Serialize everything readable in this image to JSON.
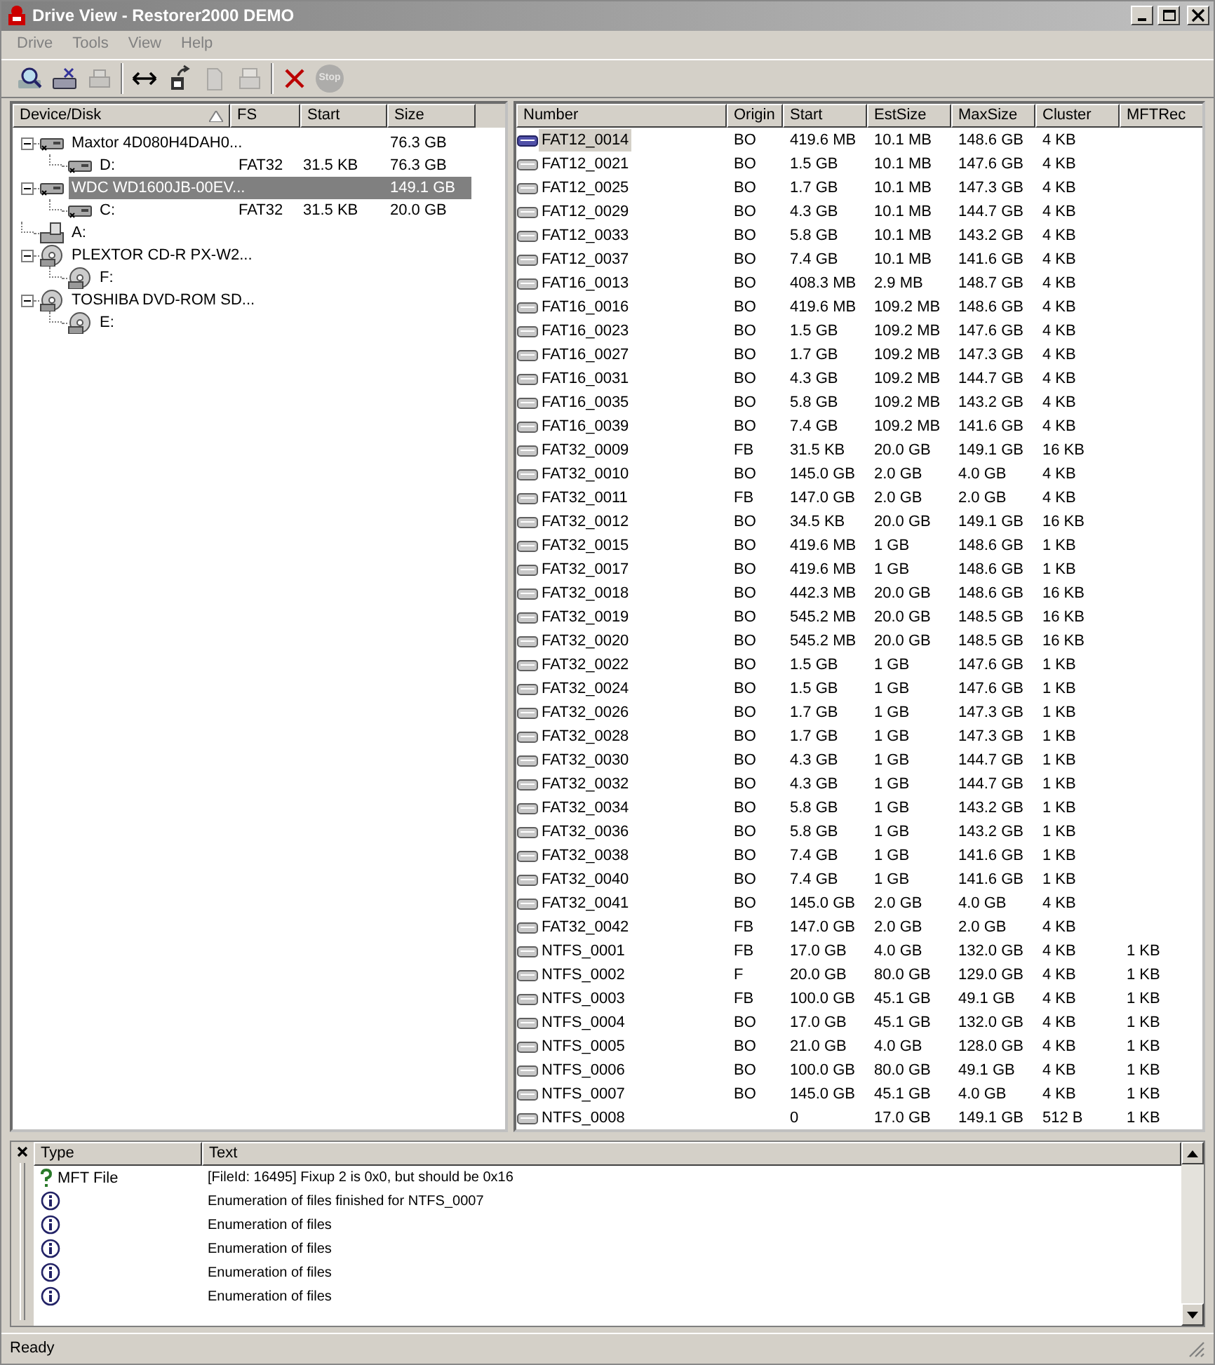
{
  "window": {
    "title": "Drive View - Restorer2000 DEMO"
  },
  "menu": [
    "Drive",
    "Tools",
    "View",
    "Help"
  ],
  "toolbar": [
    {
      "kind": "search",
      "disabled": false
    },
    {
      "kind": "drive",
      "disabled": false
    },
    {
      "kind": "printer",
      "disabled": true
    },
    {
      "kind": "sep"
    },
    {
      "kind": "arrows",
      "disabled": false
    },
    {
      "kind": "export",
      "disabled": false
    },
    {
      "kind": "file",
      "disabled": true
    },
    {
      "kind": "tray",
      "disabled": true
    },
    {
      "kind": "sep"
    },
    {
      "kind": "delete",
      "disabled": false
    },
    {
      "kind": "stop",
      "label": "Stop",
      "disabled": true
    }
  ],
  "tree": {
    "columns": [
      "Device/Disk",
      "FS",
      "Start",
      "Size"
    ],
    "items": [
      {
        "kind": "hdd",
        "label": "Maxtor 4D080H4DAH0...",
        "size": "76.3 GB",
        "selected": false,
        "expanded": true,
        "children": [
          {
            "kind": "hdd",
            "label": "D:",
            "fs": "FAT32",
            "start": "31.5 KB",
            "size": "76.3 GB",
            "selected": false
          }
        ]
      },
      {
        "kind": "hdd",
        "label": "WDC WD1600JB-00EV...",
        "size": "149.1 GB",
        "selected": true,
        "expanded": true,
        "children": [
          {
            "kind": "hdd",
            "label": "C:",
            "fs": "FAT32",
            "start": "31.5 KB",
            "size": "20.0 GB",
            "selected": false
          }
        ]
      },
      {
        "kind": "floppy",
        "label": "A:",
        "selected": false
      },
      {
        "kind": "cd",
        "label": "PLEXTOR CD-R PX-W2...",
        "selected": false,
        "expanded": true,
        "children": [
          {
            "kind": "cd",
            "label": "F:",
            "selected": false
          }
        ]
      },
      {
        "kind": "cd",
        "label": "TOSHIBA DVD-ROM SD...",
        "selected": false,
        "expanded": true,
        "children": [
          {
            "kind": "cd",
            "label": "E:",
            "selected": false
          }
        ]
      }
    ]
  },
  "table": {
    "columns": [
      "Number",
      "Origin",
      "Start",
      "EstSize",
      "MaxSize",
      "Cluster",
      "MFTRec"
    ],
    "rows": [
      {
        "number": "FAT12_0014",
        "origin": "BO",
        "start": "419.6 MB",
        "est_size": "10.1 MB",
        "max_size": "148.6 GB",
        "cluster": "4 KB",
        "selected": true
      },
      {
        "number": "FAT12_0021",
        "origin": "BO",
        "start": "1.5 GB",
        "est_size": "10.1 MB",
        "max_size": "147.6 GB",
        "cluster": "4 KB",
        "selected": false
      },
      {
        "number": "FAT12_0025",
        "origin": "BO",
        "start": "1.7 GB",
        "est_size": "10.1 MB",
        "max_size": "147.3 GB",
        "cluster": "4 KB",
        "selected": false
      },
      {
        "number": "FAT12_0029",
        "origin": "BO",
        "start": "4.3 GB",
        "est_size": "10.1 MB",
        "max_size": "144.7 GB",
        "cluster": "4 KB",
        "selected": false
      },
      {
        "number": "FAT12_0033",
        "origin": "BO",
        "start": "5.8 GB",
        "est_size": "10.1 MB",
        "max_size": "143.2 GB",
        "cluster": "4 KB",
        "selected": false
      },
      {
        "number": "FAT12_0037",
        "origin": "BO",
        "start": "7.4 GB",
        "est_size": "10.1 MB",
        "max_size": "141.6 GB",
        "cluster": "4 KB",
        "selected": false
      },
      {
        "number": "FAT16_0013",
        "origin": "BO",
        "start": "408.3 MB",
        "est_size": "2.9 MB",
        "max_size": "148.7 GB",
        "cluster": "4 KB",
        "selected": false
      },
      {
        "number": "FAT16_0016",
        "origin": "BO",
        "start": "419.6 MB",
        "est_size": "109.2 MB",
        "max_size": "148.6 GB",
        "cluster": "4 KB",
        "selected": false
      },
      {
        "number": "FAT16_0023",
        "origin": "BO",
        "start": "1.5 GB",
        "est_size": "109.2 MB",
        "max_size": "147.6 GB",
        "cluster": "4 KB",
        "selected": false
      },
      {
        "number": "FAT16_0027",
        "origin": "BO",
        "start": "1.7 GB",
        "est_size": "109.2 MB",
        "max_size": "147.3 GB",
        "cluster": "4 KB",
        "selected": false
      },
      {
        "number": "FAT16_0031",
        "origin": "BO",
        "start": "4.3 GB",
        "est_size": "109.2 MB",
        "max_size": "144.7 GB",
        "cluster": "4 KB",
        "selected": false
      },
      {
        "number": "FAT16_0035",
        "origin": "BO",
        "start": "5.8 GB",
        "est_size": "109.2 MB",
        "max_size": "143.2 GB",
        "cluster": "4 KB",
        "selected": false
      },
      {
        "number": "FAT16_0039",
        "origin": "BO",
        "start": "7.4 GB",
        "est_size": "109.2 MB",
        "max_size": "141.6 GB",
        "cluster": "4 KB",
        "selected": false
      },
      {
        "number": "FAT32_0009",
        "origin": "FB",
        "start": "31.5 KB",
        "est_size": "20.0 GB",
        "max_size": "149.1 GB",
        "cluster": "16 KB",
        "selected": false
      },
      {
        "number": "FAT32_0010",
        "origin": "BO",
        "start": "145.0 GB",
        "est_size": "2.0 GB",
        "max_size": "4.0 GB",
        "cluster": "4 KB",
        "selected": false
      },
      {
        "number": "FAT32_0011",
        "origin": "FB",
        "start": "147.0 GB",
        "est_size": "2.0 GB",
        "max_size": "2.0 GB",
        "cluster": "4 KB",
        "selected": false
      },
      {
        "number": "FAT32_0012",
        "origin": "BO",
        "start": "34.5 KB",
        "est_size": "20.0 GB",
        "max_size": "149.1 GB",
        "cluster": "16 KB",
        "selected": false
      },
      {
        "number": "FAT32_0015",
        "origin": "BO",
        "start": "419.6 MB",
        "est_size": "1 GB",
        "max_size": "148.6 GB",
        "cluster": "1 KB",
        "selected": false
      },
      {
        "number": "FAT32_0017",
        "origin": "BO",
        "start": "419.6 MB",
        "est_size": "1 GB",
        "max_size": "148.6 GB",
        "cluster": "1 KB",
        "selected": false
      },
      {
        "number": "FAT32_0018",
        "origin": "BO",
        "start": "442.3 MB",
        "est_size": "20.0 GB",
        "max_size": "148.6 GB",
        "cluster": "16 KB",
        "selected": false
      },
      {
        "number": "FAT32_0019",
        "origin": "BO",
        "start": "545.2 MB",
        "est_size": "20.0 GB",
        "max_size": "148.5 GB",
        "cluster": "16 KB",
        "selected": false
      },
      {
        "number": "FAT32_0020",
        "origin": "BO",
        "start": "545.2 MB",
        "est_size": "20.0 GB",
        "max_size": "148.5 GB",
        "cluster": "16 KB",
        "selected": false
      },
      {
        "number": "FAT32_0022",
        "origin": "BO",
        "start": "1.5 GB",
        "est_size": "1 GB",
        "max_size": "147.6 GB",
        "cluster": "1 KB",
        "selected": false
      },
      {
        "number": "FAT32_0024",
        "origin": "BO",
        "start": "1.5 GB",
        "est_size": "1 GB",
        "max_size": "147.6 GB",
        "cluster": "1 KB",
        "selected": false
      },
      {
        "number": "FAT32_0026",
        "origin": "BO",
        "start": "1.7 GB",
        "est_size": "1 GB",
        "max_size": "147.3 GB",
        "cluster": "1 KB",
        "selected": false
      },
      {
        "number": "FAT32_0028",
        "origin": "BO",
        "start": "1.7 GB",
        "est_size": "1 GB",
        "max_size": "147.3 GB",
        "cluster": "1 KB",
        "selected": false
      },
      {
        "number": "FAT32_0030",
        "origin": "BO",
        "start": "4.3 GB",
        "est_size": "1 GB",
        "max_size": "144.7 GB",
        "cluster": "1 KB",
        "selected": false
      },
      {
        "number": "FAT32_0032",
        "origin": "BO",
        "start": "4.3 GB",
        "est_size": "1 GB",
        "max_size": "144.7 GB",
        "cluster": "1 KB",
        "selected": false
      },
      {
        "number": "FAT32_0034",
        "origin": "BO",
        "start": "5.8 GB",
        "est_size": "1 GB",
        "max_size": "143.2 GB",
        "cluster": "1 KB",
        "selected": false
      },
      {
        "number": "FAT32_0036",
        "origin": "BO",
        "start": "5.8 GB",
        "est_size": "1 GB",
        "max_size": "143.2 GB",
        "cluster": "1 KB",
        "selected": false
      },
      {
        "number": "FAT32_0038",
        "origin": "BO",
        "start": "7.4 GB",
        "est_size": "1 GB",
        "max_size": "141.6 GB",
        "cluster": "1 KB",
        "selected": false
      },
      {
        "number": "FAT32_0040",
        "origin": "BO",
        "start": "7.4 GB",
        "est_size": "1 GB",
        "max_size": "141.6 GB",
        "cluster": "1 KB",
        "selected": false
      },
      {
        "number": "FAT32_0041",
        "origin": "BO",
        "start": "145.0 GB",
        "est_size": "2.0 GB",
        "max_size": "4.0 GB",
        "cluster": "4 KB",
        "selected": false
      },
      {
        "number": "FAT32_0042",
        "origin": "FB",
        "start": "147.0 GB",
        "est_size": "2.0 GB",
        "max_size": "2.0 GB",
        "cluster": "4 KB",
        "selected": false
      },
      {
        "number": "NTFS_0001",
        "origin": "FB",
        "start": "17.0 GB",
        "est_size": "4.0 GB",
        "max_size": "132.0 GB",
        "cluster": "4 KB",
        "mft_rec": "1 KB",
        "selected": false
      },
      {
        "number": "NTFS_0002",
        "origin": "F",
        "start": "20.0 GB",
        "est_size": "80.0 GB",
        "max_size": "129.0 GB",
        "cluster": "4 KB",
        "mft_rec": "1 KB",
        "selected": false
      },
      {
        "number": "NTFS_0003",
        "origin": "FB",
        "start": "100.0 GB",
        "est_size": "45.1 GB",
        "max_size": "49.1 GB",
        "cluster": "4 KB",
        "mft_rec": "1 KB",
        "selected": false
      },
      {
        "number": "NTFS_0004",
        "origin": "BO",
        "start": "17.0 GB",
        "est_size": "45.1 GB",
        "max_size": "132.0 GB",
        "cluster": "4 KB",
        "mft_rec": "1 KB",
        "selected": false
      },
      {
        "number": "NTFS_0005",
        "origin": "BO",
        "start": "21.0 GB",
        "est_size": "4.0 GB",
        "max_size": "128.0 GB",
        "cluster": "4 KB",
        "mft_rec": "1 KB",
        "selected": false
      },
      {
        "number": "NTFS_0006",
        "origin": "BO",
        "start": "100.0 GB",
        "est_size": "80.0 GB",
        "max_size": "49.1 GB",
        "cluster": "4 KB",
        "mft_rec": "1 KB",
        "selected": false
      },
      {
        "number": "NTFS_0007",
        "origin": "BO",
        "start": "145.0 GB",
        "est_size": "45.1 GB",
        "max_size": "4.0 GB",
        "cluster": "4 KB",
        "mft_rec": "1 KB",
        "selected": false
      },
      {
        "number": "NTFS_0008",
        "start": "0",
        "est_size": "17.0 GB",
        "max_size": "149.1 GB",
        "cluster": "512 B",
        "mft_rec": "1 KB",
        "selected": false
      }
    ]
  },
  "log": {
    "columns": [
      "Type",
      "Text"
    ],
    "entries": [
      {
        "kind": "question",
        "type": "MFT File",
        "text": "[FileId: 16495] Fixup 2 is 0x0, but should be 0x16"
      },
      {
        "kind": "info",
        "text": "Enumeration of files finished for NTFS_0007"
      },
      {
        "kind": "info",
        "text": "Enumeration of files"
      },
      {
        "kind": "info",
        "text": "Enumeration of files"
      },
      {
        "kind": "info",
        "text": "Enumeration of files"
      },
      {
        "kind": "info",
        "text": "Enumeration of files"
      }
    ]
  },
  "status_bar": "Ready"
}
